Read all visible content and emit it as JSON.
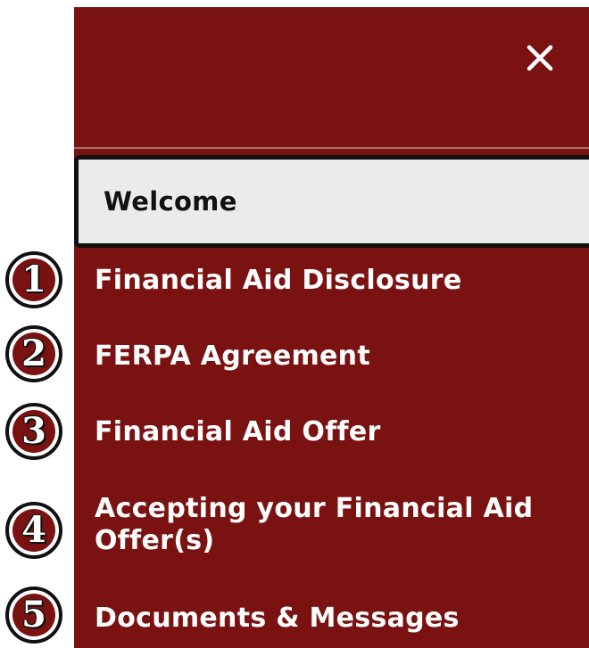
{
  "menu": {
    "close_icon": "close-icon",
    "welcome_label": "Welcome",
    "steps": [
      {
        "number": "1",
        "label": "Financial Aid Disclosure"
      },
      {
        "number": "2",
        "label": "FERPA Agreement"
      },
      {
        "number": "3",
        "label": "Financial Aid Offer"
      },
      {
        "number": "4",
        "label": "Accepting your Financial Aid Offer(s)"
      },
      {
        "number": "5",
        "label": "Documents & Messages"
      }
    ]
  },
  "colors": {
    "panel_background": "#7a1212",
    "welcome_background": "#ebebeb",
    "text_light": "#ffffff",
    "text_dark": "#111111"
  }
}
